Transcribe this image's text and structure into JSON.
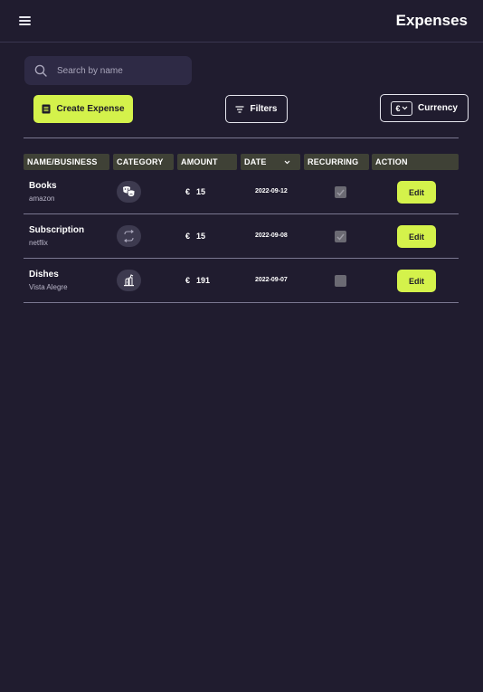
{
  "header": {
    "title": "Expenses"
  },
  "search": {
    "placeholder": "Search by name",
    "value": ""
  },
  "toolbar": {
    "create_label": "Create Expense",
    "filters_label": "Filters",
    "currency_label": "Currency",
    "currency_symbol": "€"
  },
  "colors": {
    "accent": "#d4f24b",
    "background": "#201c2f",
    "header_cell": "#3f4136"
  },
  "table": {
    "columns": [
      "NAME/BUSINESS",
      "CATEGORY",
      "AMOUNT",
      "DATE",
      "RECURRING",
      "ACTION"
    ],
    "sort_indicator": "chevron-down-icon",
    "rows": [
      {
        "name": "Books",
        "business": "amazon",
        "category_icon": "theater-masks-icon",
        "currency": "€",
        "amount": "15",
        "date": "2022-09-12",
        "recurring": true,
        "action": "Edit"
      },
      {
        "name": "Subscription",
        "business": "netflix",
        "category_icon": "repeat-icon",
        "currency": "€",
        "amount": "15",
        "date": "2022-09-08",
        "recurring": true,
        "action": "Edit"
      },
      {
        "name": "Dishes",
        "business": "Vista Alegre",
        "category_icon": "household-icon",
        "currency": "€",
        "amount": "191",
        "date": "2022-09-07",
        "recurring": false,
        "action": "Edit"
      }
    ]
  }
}
